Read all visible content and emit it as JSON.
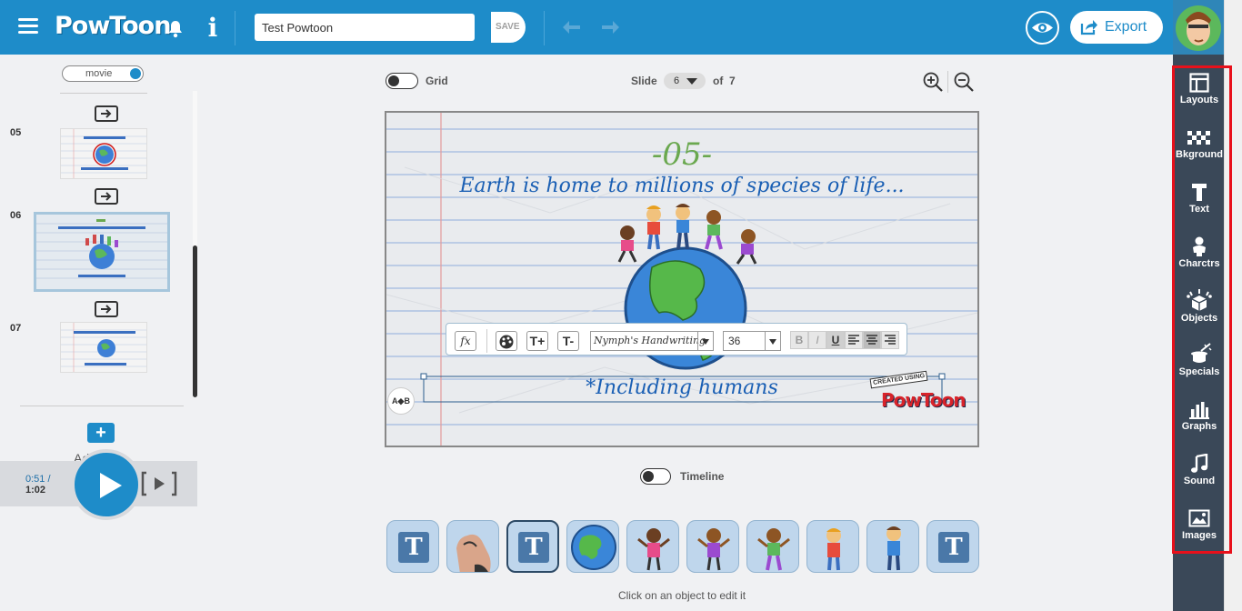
{
  "topbar": {
    "logo": "PowToon",
    "title_value": "Test Powtoon",
    "save_label": "SAVE",
    "export_label": "Export"
  },
  "left_panel": {
    "mode_label": "movie",
    "slides": [
      {
        "number": "05"
      },
      {
        "number": "06",
        "selected": true
      },
      {
        "number": "07"
      }
    ],
    "add_slide_label": "Add Slide"
  },
  "player": {
    "elapsed": "0:51 /",
    "total": "1:02"
  },
  "canvas_toolbar": {
    "grid_label": "Grid",
    "slide_label": "Slide",
    "slide_current": "6",
    "of_label": "of",
    "slide_total": "7"
  },
  "slide": {
    "heading": "-05-",
    "subtitle": "Earth is home to millions of species of life...",
    "selected_text": "*Including humans",
    "watermark_small": "CREATED USING",
    "watermark_big": "PowToon",
    "transition_label": "A◆B"
  },
  "text_toolbar": {
    "fx_label": "fx",
    "font_name": "Nymph's Handwriting",
    "font_size": "36",
    "bold": "B",
    "italic": "I",
    "underline": "U"
  },
  "timeline": {
    "label": "Timeline",
    "hint": "Click on an object to edit it"
  },
  "right_sidebar": {
    "items": [
      {
        "label": "Layouts",
        "icon": "layout-icon"
      },
      {
        "label": "Bkground",
        "icon": "background-icon"
      },
      {
        "label": "Text",
        "icon": "text-icon"
      },
      {
        "label": "Charctrs",
        "icon": "characters-icon"
      },
      {
        "label": "Objects",
        "icon": "objects-icon"
      },
      {
        "label": "Specials",
        "icon": "magic-hat-icon"
      },
      {
        "label": "Graphs",
        "icon": "bar-chart-icon"
      },
      {
        "label": "Sound",
        "icon": "music-note-icon"
      },
      {
        "label": "Images",
        "icon": "image-icon"
      }
    ]
  },
  "colors": {
    "brand_blue": "#1e8cc9",
    "sidebar_dark": "#3a4858",
    "highlight_red": "#e8101b",
    "slide_text_blue": "#1a5fb4",
    "heading_green": "#6aa84f"
  }
}
